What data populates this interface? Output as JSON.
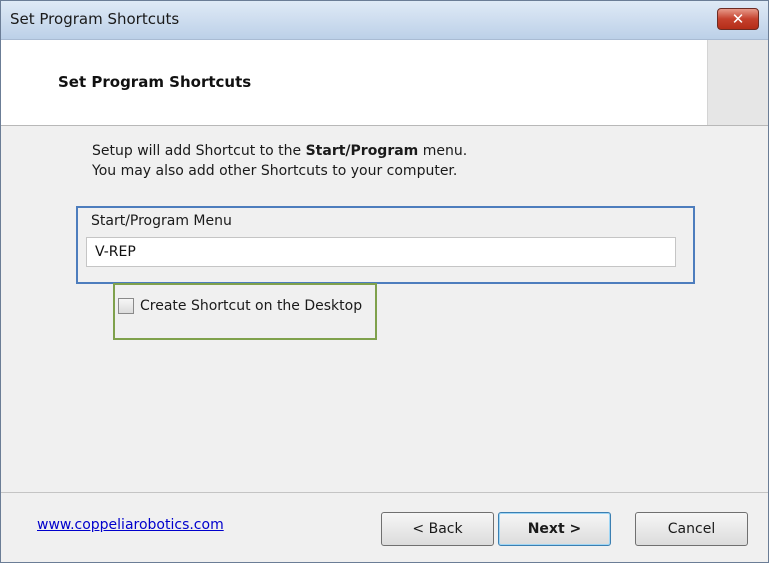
{
  "window": {
    "title": "Set Program Shortcuts",
    "close_label": "✕"
  },
  "header": {
    "title": "Set Program Shortcuts"
  },
  "intro": {
    "line1_prefix": "Setup will add Shortcut to the ",
    "line1_bold": "Start/Program",
    "line1_suffix": " menu.",
    "line2": "You may also add other Shortcuts to your computer."
  },
  "start_menu_group": {
    "label": "Start/Program Menu",
    "value": "V-REP"
  },
  "desktop_shortcut": {
    "label": "Create Shortcut on the Desktop",
    "checked": false
  },
  "footer": {
    "link": "www.coppeliarobotics.com",
    "back_label": "< Back",
    "next_label": "Next >",
    "cancel_label": "Cancel"
  }
}
